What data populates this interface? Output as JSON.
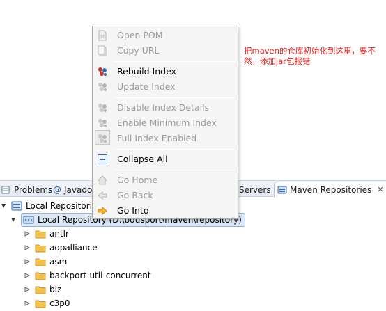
{
  "context_menu": {
    "items": [
      {
        "label": "Open POM",
        "icon": "pom-file-icon",
        "enabled": false
      },
      {
        "label": "Copy URL",
        "icon": "copy-icon",
        "enabled": false
      },
      {
        "label": "Rebuild Index",
        "icon": "rebuild-index-icon",
        "enabled": true
      },
      {
        "label": "Update Index",
        "icon": "update-index-icon",
        "enabled": false
      },
      {
        "label": "Disable Index Details",
        "icon": "index-details-icon",
        "enabled": false
      },
      {
        "label": "Enable Minimum Index",
        "icon": "minimum-index-icon",
        "enabled": false
      },
      {
        "label": "Full Index Enabled",
        "icon": "full-index-icon",
        "enabled": false
      },
      {
        "label": "Collapse All",
        "icon": "collapse-all-icon",
        "enabled": true
      },
      {
        "label": "Go Home",
        "icon": "home-icon",
        "enabled": false
      },
      {
        "label": "Go Back",
        "icon": "back-arrow-icon",
        "enabled": false
      },
      {
        "label": "Go Into",
        "icon": "go-into-arrow-icon",
        "enabled": true
      }
    ]
  },
  "annotation": {
    "text": "把maven的仓库初始化到这里，要不然，添加jar包报错"
  },
  "tabs": {
    "problems": "Problems",
    "javadoc": "Javado",
    "servers": "Servers",
    "maven_repositories": "Maven Repositories",
    "close_glyph": "✕"
  },
  "tree": {
    "root_label": "Local Repositories",
    "local_repo_label": "Local Repository (D:\\bdusport\\maven\\repository)",
    "folders": [
      "antlr",
      "aopalliance",
      "asm",
      "backport-util-concurrent",
      "biz",
      "c3p0"
    ]
  },
  "colors": {
    "annotation": "#e02020",
    "disabled_text": "#9a9a9a",
    "folder": "#f2c14e",
    "go_into_arrow": "#f0a020"
  }
}
